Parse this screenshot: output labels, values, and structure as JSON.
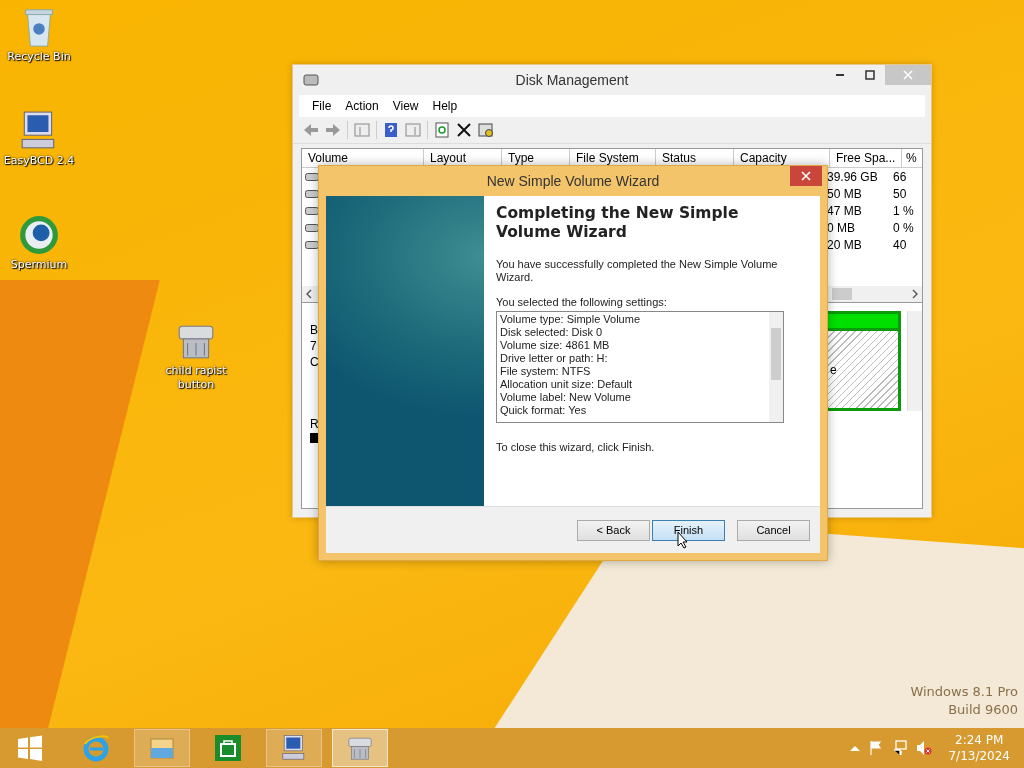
{
  "desktop_icons": [
    {
      "kind": "recycle",
      "label": "Recycle Bin"
    },
    {
      "kind": "monitor",
      "label": "EasyBCD 2.4"
    },
    {
      "kind": "globe",
      "label": "Spermium"
    },
    {
      "kind": "drive",
      "label": "child rapist button"
    }
  ],
  "edition": {
    "name": "Windows 8.1 Pro",
    "build": "Build 9600"
  },
  "disk_window": {
    "title": "Disk Management",
    "menu": [
      "File",
      "Action",
      "View",
      "Help"
    ],
    "columns": [
      "Volume",
      "Layout",
      "Type",
      "File System",
      "Status",
      "Capacity",
      "Free Spa...",
      "%"
    ],
    "rows": [
      {
        "free": "39.96 GB",
        "percent": "66"
      },
      {
        "free": "50 MB",
        "percent": "50"
      },
      {
        "free": "47 MB",
        "percent": "1 %"
      },
      {
        "free": "0 MB",
        "percent": "0 %"
      },
      {
        "free": "20 MB",
        "percent": "40"
      }
    ],
    "disk_fragments": [
      "B",
      "7",
      "C"
    ],
    "second_disk_fragment": "R",
    "partition_fragment": "e"
  },
  "wizard": {
    "title": "New Simple Volume Wizard",
    "heading": "Completing the New Simple Volume Wizard",
    "intro": "You have successfully completed the New Simple Volume Wizard.",
    "settings_label": "You selected the following settings:",
    "settings": [
      "Volume type: Simple Volume",
      "Disk selected: Disk 0",
      "Volume size: 4861 MB",
      "Drive letter or path: H:",
      "File system: NTFS",
      "Allocation unit size: Default",
      "Volume label: New Volume",
      "Quick format: Yes"
    ],
    "closing": "To close this wizard, click Finish.",
    "buttons": [
      {
        "label": "< Back",
        "focused": false
      },
      {
        "label": "Finish",
        "focused": true
      },
      {
        "label": "Cancel",
        "focused": false
      }
    ]
  },
  "taskbar": {
    "items": [
      {
        "kind": "start",
        "running": false,
        "selected": false
      },
      {
        "kind": "browser",
        "running": false,
        "selected": false
      },
      {
        "kind": "folder",
        "running": true,
        "selected": false
      },
      {
        "kind": "store",
        "running": false,
        "selected": false
      },
      {
        "kind": "monitor",
        "running": true,
        "selected": false
      },
      {
        "kind": "drive",
        "running": true,
        "selected": true
      }
    ],
    "time": "2:24 PM",
    "date": "7/13/2024"
  }
}
